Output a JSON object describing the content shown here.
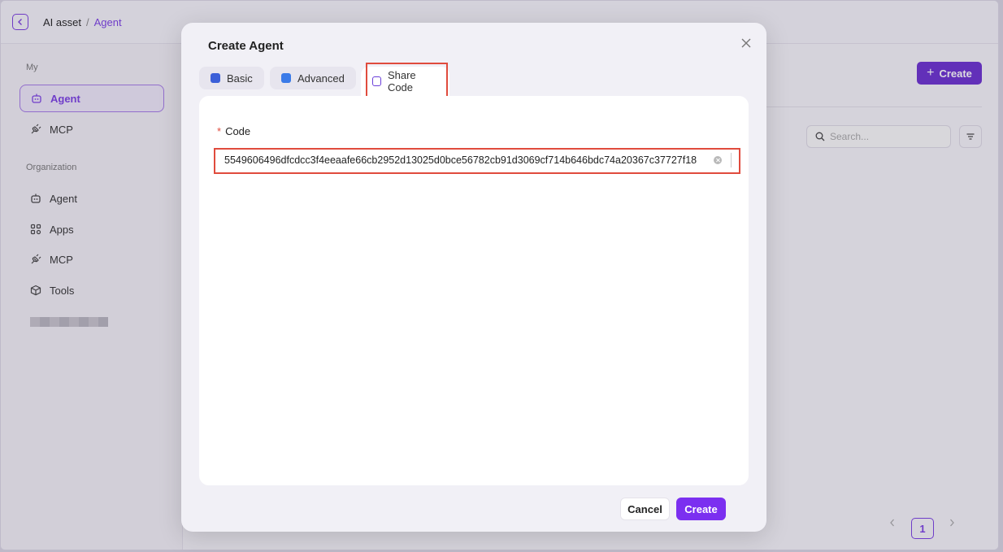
{
  "breadcrumb": {
    "root": "AI asset",
    "separator": "/",
    "current": "Agent"
  },
  "sidebar": {
    "sections": [
      {
        "label": "My"
      },
      {
        "label": "Organization"
      }
    ],
    "my_items": [
      {
        "label": "Agent",
        "icon": "bot-icon",
        "active": true
      },
      {
        "label": "MCP",
        "icon": "plug-icon",
        "active": false
      }
    ],
    "org_items": [
      {
        "label": "Agent",
        "icon": "bot-icon"
      },
      {
        "label": "Apps",
        "icon": "apps-icon"
      },
      {
        "label": "MCP",
        "icon": "plug-icon"
      },
      {
        "label": "Tools",
        "icon": "box-icon"
      }
    ]
  },
  "main": {
    "create_label": "Create",
    "search_placeholder": "Search...",
    "pagination": {
      "current_page": "1"
    }
  },
  "modal": {
    "title": "Create Agent",
    "tabs": [
      {
        "label": "Basic",
        "icon": "layers-icon",
        "color": "#3b5fd8"
      },
      {
        "label": "Advanced",
        "icon": "grid-icon",
        "color": "#3b7be8"
      },
      {
        "label": "Share Code",
        "icon": "code-square-icon",
        "color": "#6a3fd9",
        "active": true
      }
    ],
    "form": {
      "code_label": "Code",
      "required_mark": "*",
      "code_value": "5549606496dfcdcc3f4eeaafe66cb2952d13025d0bce56782cb91d3069cf714b646bdc74a20367c37727f18"
    },
    "cancel_label": "Cancel",
    "create_label": "Create"
  },
  "colors": {
    "accent": "#7b2ff0",
    "highlight": "#e04b3d"
  }
}
